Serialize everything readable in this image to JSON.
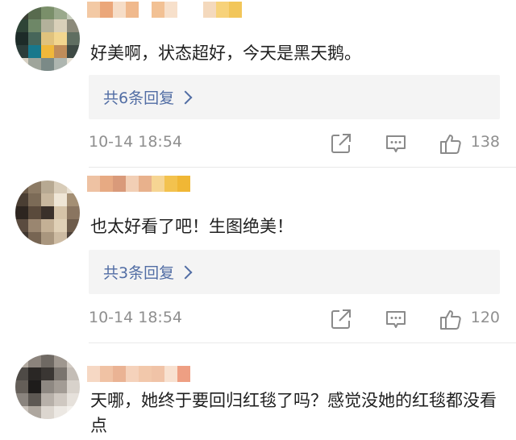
{
  "comments": [
    {
      "text": "好美啊，状态超好，今天是黑天鹅。",
      "reply_label": "共6条回复",
      "time": "10-14 18:54",
      "likes": "138",
      "avatar_colors": [
        "#3a3f33",
        "#586b4e",
        "#7a8f6a",
        "#9aa98c",
        "#c7cdbd",
        "#2e4437",
        "#6e8767",
        "#b3b19b",
        "#d9d0b9",
        "#8c8a7a",
        "#1d2b28",
        "#47665a",
        "#e0c27d",
        "#f2d68f",
        "#5f6e61",
        "#2c3d3a",
        "#18788c",
        "#f0b83a",
        "#c08d5a",
        "#3e4a44",
        "#d7d0c2",
        "#9fa59b",
        "#7b8a87",
        "#aeb6b0",
        "#e8e2d6"
      ],
      "name_colors": [
        "#f3c9a4",
        "#eba77a",
        "#f6ddc7",
        "#f0b98d",
        "#ffffff",
        "#f2c194",
        "#f7e0cb",
        "#ffffff",
        "#ffffff",
        "#f4d9bd",
        "#f7d27a",
        "#f2c65a"
      ]
    },
    {
      "text": "也太好看了吧！生图绝美！",
      "reply_label": "共3条回复",
      "time": "10-14 18:54",
      "likes": "120",
      "avatar_colors": [
        "#6b5a48",
        "#8c7a64",
        "#b7a992",
        "#d8ccb8",
        "#e9e1d3",
        "#4a3e33",
        "#7c6b57",
        "#c8b79e",
        "#efe6d6",
        "#a48f74",
        "#2d2520",
        "#5a4a3c",
        "#3a302a",
        "#d5c3a8",
        "#8a7560",
        "#5b4c40",
        "#9a8670",
        "#c4b095",
        "#e0d0b6",
        "#6e5c4b",
        "#3f362f",
        "#776553",
        "#a9967e",
        "#cdbba2",
        "#4f433a"
      ],
      "name_colors": [
        "#eec2a3",
        "#e7aa83",
        "#d99a7a",
        "#f2cfb5",
        "#e8b18c",
        "#f6d593",
        "#f3c24e",
        "#f0b735"
      ]
    },
    {
      "text": "天哪，她终于要回归红毯了吗？感觉没她的红毯都没看点",
      "avatar_colors": [
        "#b3aba2",
        "#8b837c",
        "#6f6963",
        "#9f978f",
        "#d2cbc3",
        "#4e4a46",
        "#2a2725",
        "#3a3633",
        "#7a746e",
        "#c4bdb6",
        "#645e58",
        "#1e1c1b",
        "#8e8882",
        "#a39c95",
        "#d8d2cb",
        "#8a847e",
        "#5d5853",
        "#b7b0a9",
        "#cfc8c1",
        "#e6e1db",
        "#c9c2bb",
        "#aea79f",
        "#dcd6cf",
        "#ece8e3",
        "#f3f0ec"
      ],
      "name_colors": [
        "#f6d8c4",
        "#f0c2a4",
        "#eab394",
        "#f5d2bb",
        "#f2c8ab",
        "#f0c3a7",
        "#f8e1d0",
        "#ee9f83"
      ]
    }
  ],
  "icons": {
    "share": "share-icon",
    "comment": "comment-icon",
    "like": "thumbs-up-icon"
  }
}
